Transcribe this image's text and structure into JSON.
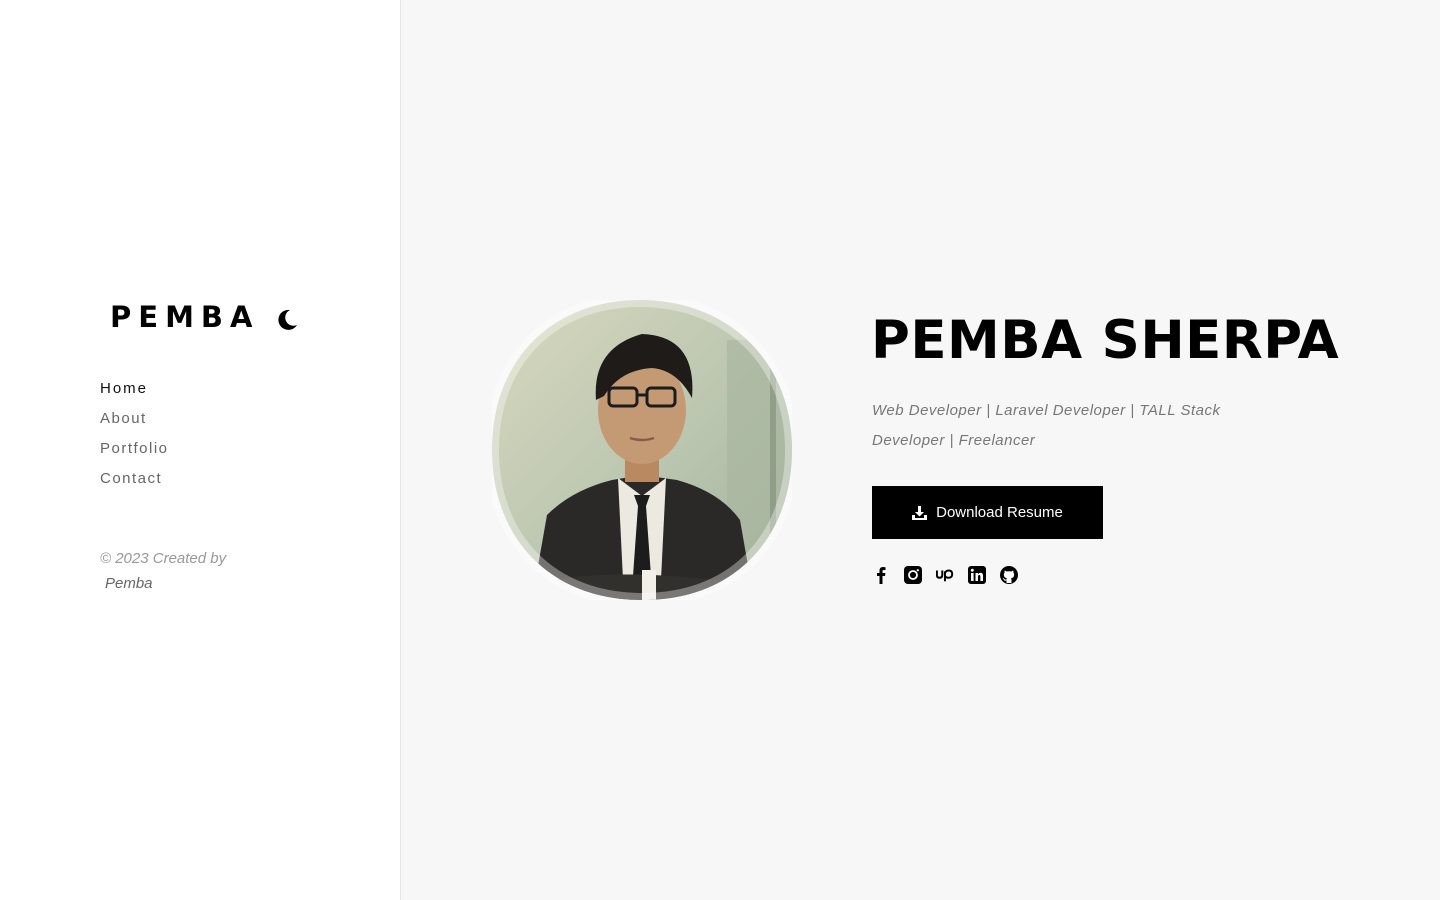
{
  "sidebar": {
    "brand": "PEMBA",
    "theme_toggle_icon": "moon-icon",
    "nav": [
      {
        "label": "Home",
        "active": true
      },
      {
        "label": "About",
        "active": false
      },
      {
        "label": "Portfolio",
        "active": false
      },
      {
        "label": "Contact",
        "active": false
      }
    ],
    "footer": {
      "text": "© 2023 Created by",
      "author": "Pemba"
    }
  },
  "hero": {
    "avatar_icon": "profile-photo",
    "name": "PEMBA SHERPA",
    "tagline": "Web Developer | Laravel Developer | TALL Stack Developer | Freelancer",
    "download_label": "Download Resume",
    "download_icon": "download-icon",
    "socials": [
      "facebook-icon",
      "instagram-icon",
      "upwork-icon",
      "linkedin-icon",
      "github-icon"
    ]
  },
  "colors": {
    "sidebar_bg": "#ffffff",
    "main_bg": "#f7f7f7",
    "accent": "#000000",
    "nav_text": "#666666",
    "muted_text": "#999999"
  }
}
